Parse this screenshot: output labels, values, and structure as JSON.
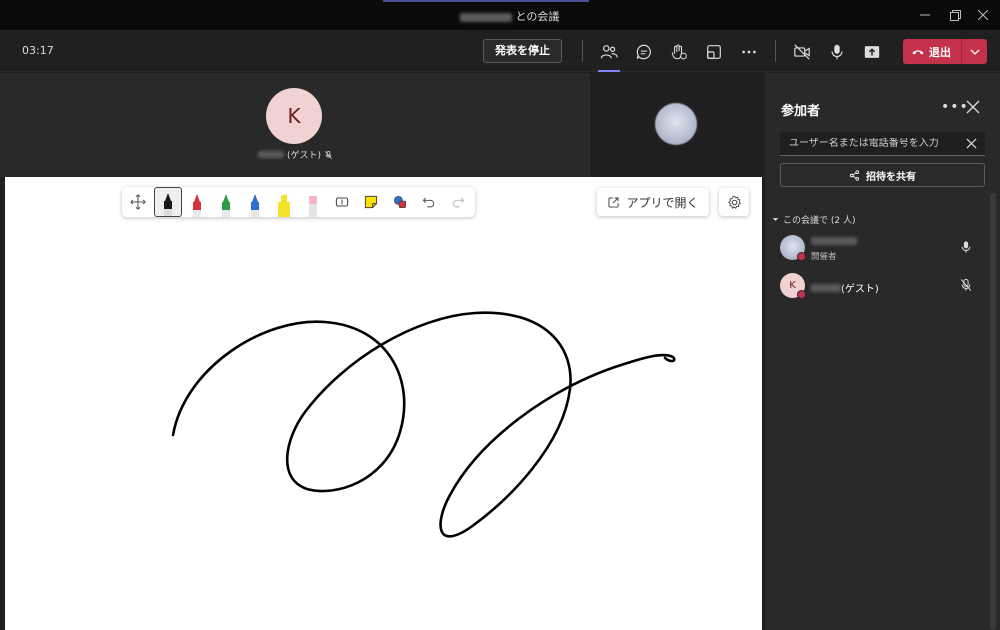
{
  "window": {
    "title_suffix": "との会議",
    "controls": [
      "minimize-icon",
      "restore-icon",
      "close-icon"
    ]
  },
  "topbar": {
    "timer": "03:17",
    "stop_presenting": "発表を停止",
    "leave": "退出",
    "icons": [
      "people-icon",
      "chat-icon",
      "reactions-icon",
      "rooms-icon",
      "more-icon",
      "camera-off-icon",
      "mic-icon",
      "share-icon"
    ]
  },
  "stage": {
    "main_avatar_initial": "K",
    "main_name_suffix": "(ゲスト)"
  },
  "whiteboard": {
    "open_app": "アプリで開く",
    "pen_colors": [
      "#1a1a1a",
      "#d13438",
      "#2e9b43",
      "#2b6fd1",
      "#f5e12a",
      "#f4b6c2"
    ],
    "tools": [
      "move-icon",
      "black-pen",
      "red-pen",
      "green-pen",
      "blue-pen",
      "yellow-highlighter",
      "eraser",
      "text-icon",
      "sticky-note-icon",
      "shapes-icon",
      "undo-icon",
      "redo-icon"
    ]
  },
  "panel": {
    "title": "参加者",
    "search_placeholder": "ユーザー名または電話番号を入力",
    "share_invite": "招待を共有",
    "section_label": "この会議で (2 人)",
    "participants": [
      {
        "role": "開催者",
        "name_suffix": "",
        "mic": "on"
      },
      {
        "role": "",
        "initial": "K",
        "name_suffix": "(ゲスト)",
        "mic": "muted"
      }
    ]
  },
  "colors": {
    "accent": "#7f85f5",
    "leave": "#c4314b",
    "avatar_bg": "#f0d2d2"
  }
}
